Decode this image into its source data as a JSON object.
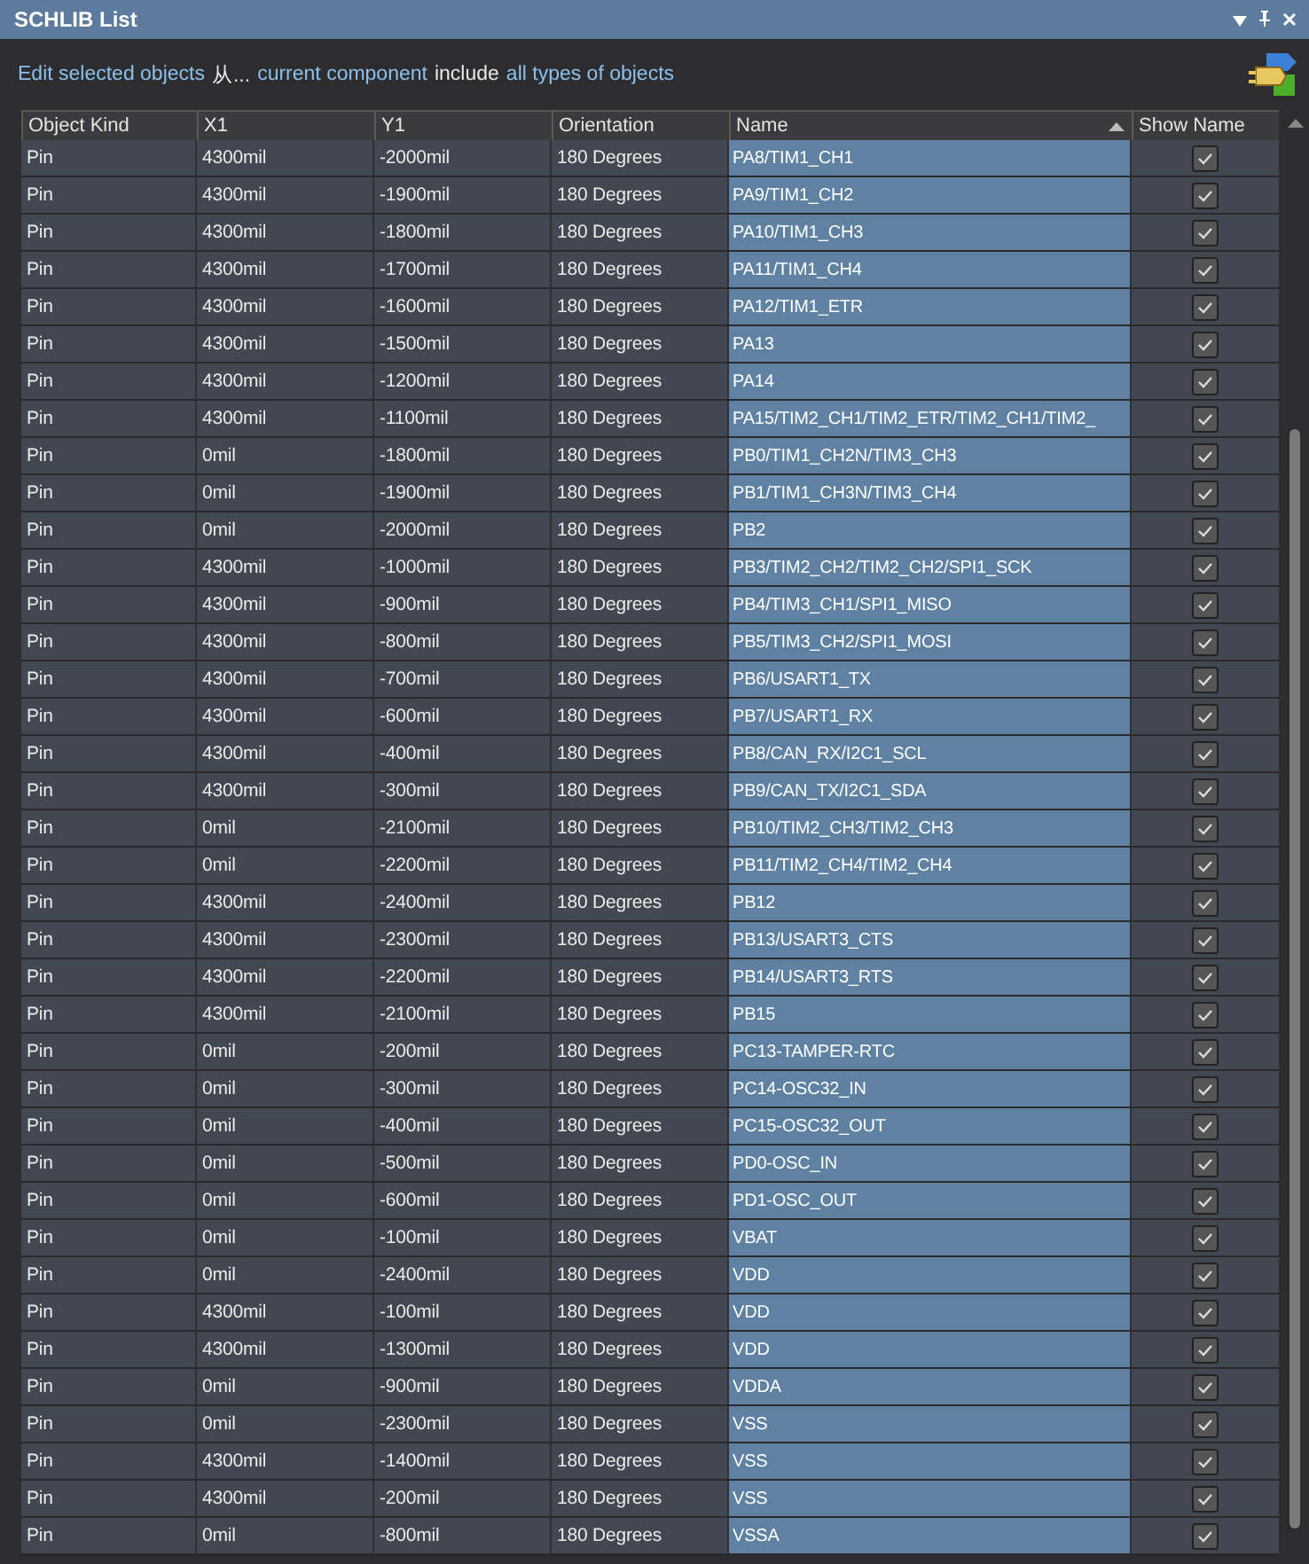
{
  "panel": {
    "title": "SCHLIB List",
    "buttons": [
      {
        "kind": "menu"
      },
      {
        "kind": "pin"
      },
      {
        "kind": "close"
      }
    ]
  },
  "filter": [
    {
      "kind": "link",
      "text": "Edit selected objects"
    },
    {
      "kind": "plain",
      "text": "从..."
    },
    {
      "kind": "link",
      "text": "current component"
    },
    {
      "kind": "plain",
      "text": "include"
    },
    {
      "kind": "link",
      "text": "all types of objects"
    }
  ],
  "table": {
    "columns": [
      {
        "label": "Object Kind",
        "sorted": false
      },
      {
        "label": "X1",
        "sorted": false
      },
      {
        "label": "Y1",
        "sorted": false
      },
      {
        "label": "Orientation",
        "sorted": false
      },
      {
        "label": "Name",
        "sorted": true
      },
      {
        "label": "Show Name",
        "sorted": false
      }
    ],
    "rows": [
      {
        "kind": "Pin",
        "x1": "4300mil",
        "y1": "-2000mil",
        "orientation": "180 Degrees",
        "name": "PA8/TIM1_CH1",
        "show_name": true,
        "selected": true
      },
      {
        "kind": "Pin",
        "x1": "4300mil",
        "y1": "-1900mil",
        "orientation": "180 Degrees",
        "name": "PA9/TIM1_CH2",
        "show_name": true,
        "selected": true
      },
      {
        "kind": "Pin",
        "x1": "4300mil",
        "y1": "-1800mil",
        "orientation": "180 Degrees",
        "name": "PA10/TIM1_CH3",
        "show_name": true,
        "selected": true
      },
      {
        "kind": "Pin",
        "x1": "4300mil",
        "y1": "-1700mil",
        "orientation": "180 Degrees",
        "name": "PA11/TIM1_CH4",
        "show_name": true,
        "selected": true
      },
      {
        "kind": "Pin",
        "x1": "4300mil",
        "y1": "-1600mil",
        "orientation": "180 Degrees",
        "name": "PA12/TIM1_ETR",
        "show_name": true,
        "selected": true
      },
      {
        "kind": "Pin",
        "x1": "4300mil",
        "y1": "-1500mil",
        "orientation": "180 Degrees",
        "name": "PA13",
        "show_name": true,
        "selected": true
      },
      {
        "kind": "Pin",
        "x1": "4300mil",
        "y1": "-1200mil",
        "orientation": "180 Degrees",
        "name": "PA14",
        "show_name": true,
        "selected": true
      },
      {
        "kind": "Pin",
        "x1": "4300mil",
        "y1": "-1100mil",
        "orientation": "180 Degrees",
        "name": "PA15/TIM2_CH1/TIM2_ETR/TIM2_CH1/TIM2_",
        "show_name": true,
        "selected": true
      },
      {
        "kind": "Pin",
        "x1": "0mil",
        "y1": "-1800mil",
        "orientation": "180 Degrees",
        "name": "PB0/TIM1_CH2N/TIM3_CH3",
        "show_name": true,
        "selected": true
      },
      {
        "kind": "Pin",
        "x1": "0mil",
        "y1": "-1900mil",
        "orientation": "180 Degrees",
        "name": "PB1/TIM1_CH3N/TIM3_CH4",
        "show_name": true,
        "selected": true
      },
      {
        "kind": "Pin",
        "x1": "0mil",
        "y1": "-2000mil",
        "orientation": "180 Degrees",
        "name": "PB2",
        "show_name": true,
        "selected": true
      },
      {
        "kind": "Pin",
        "x1": "4300mil",
        "y1": "-1000mil",
        "orientation": "180 Degrees",
        "name": "PB3/TIM2_CH2/TIM2_CH2/SPI1_SCK",
        "show_name": true,
        "selected": true
      },
      {
        "kind": "Pin",
        "x1": "4300mil",
        "y1": "-900mil",
        "orientation": "180 Degrees",
        "name": "PB4/TIM3_CH1/SPI1_MISO",
        "show_name": true,
        "selected": true
      },
      {
        "kind": "Pin",
        "x1": "4300mil",
        "y1": "-800mil",
        "orientation": "180 Degrees",
        "name": "PB5/TIM3_CH2/SPI1_MOSI",
        "show_name": true,
        "selected": true
      },
      {
        "kind": "Pin",
        "x1": "4300mil",
        "y1": "-700mil",
        "orientation": "180 Degrees",
        "name": "PB6/USART1_TX",
        "show_name": true,
        "selected": true
      },
      {
        "kind": "Pin",
        "x1": "4300mil",
        "y1": "-600mil",
        "orientation": "180 Degrees",
        "name": "PB7/USART1_RX",
        "show_name": true,
        "selected": true
      },
      {
        "kind": "Pin",
        "x1": "4300mil",
        "y1": "-400mil",
        "orientation": "180 Degrees",
        "name": "PB8/CAN_RX/I2C1_SCL",
        "show_name": true,
        "selected": true
      },
      {
        "kind": "Pin",
        "x1": "4300mil",
        "y1": "-300mil",
        "orientation": "180 Degrees",
        "name": "PB9/CAN_TX/I2C1_SDA",
        "show_name": true,
        "selected": true
      },
      {
        "kind": "Pin",
        "x1": "0mil",
        "y1": "-2100mil",
        "orientation": "180 Degrees",
        "name": "PB10/TIM2_CH3/TIM2_CH3",
        "show_name": true,
        "selected": true
      },
      {
        "kind": "Pin",
        "x1": "0mil",
        "y1": "-2200mil",
        "orientation": "180 Degrees",
        "name": "PB11/TIM2_CH4/TIM2_CH4",
        "show_name": true,
        "selected": true
      },
      {
        "kind": "Pin",
        "x1": "4300mil",
        "y1": "-2400mil",
        "orientation": "180 Degrees",
        "name": "PB12",
        "show_name": true,
        "selected": true
      },
      {
        "kind": "Pin",
        "x1": "4300mil",
        "y1": "-2300mil",
        "orientation": "180 Degrees",
        "name": "PB13/USART3_CTS",
        "show_name": true,
        "selected": true
      },
      {
        "kind": "Pin",
        "x1": "4300mil",
        "y1": "-2200mil",
        "orientation": "180 Degrees",
        "name": "PB14/USART3_RTS",
        "show_name": true,
        "selected": true
      },
      {
        "kind": "Pin",
        "x1": "4300mil",
        "y1": "-2100mil",
        "orientation": "180 Degrees",
        "name": "PB15",
        "show_name": true,
        "selected": true
      },
      {
        "kind": "Pin",
        "x1": "0mil",
        "y1": "-200mil",
        "orientation": "180 Degrees",
        "name": "PC13-TAMPER-RTC",
        "show_name": true,
        "selected": true
      },
      {
        "kind": "Pin",
        "x1": "0mil",
        "y1": "-300mil",
        "orientation": "180 Degrees",
        "name": "PC14-OSC32_IN",
        "show_name": true,
        "selected": true
      },
      {
        "kind": "Pin",
        "x1": "0mil",
        "y1": "-400mil",
        "orientation": "180 Degrees",
        "name": "PC15-OSC32_OUT",
        "show_name": true,
        "selected": true
      },
      {
        "kind": "Pin",
        "x1": "0mil",
        "y1": "-500mil",
        "orientation": "180 Degrees",
        "name": "PD0-OSC_IN",
        "show_name": true,
        "selected": true
      },
      {
        "kind": "Pin",
        "x1": "0mil",
        "y1": "-600mil",
        "orientation": "180 Degrees",
        "name": "PD1-OSC_OUT",
        "show_name": true,
        "selected": true
      },
      {
        "kind": "Pin",
        "x1": "0mil",
        "y1": "-100mil",
        "orientation": "180 Degrees",
        "name": "VBAT",
        "show_name": true,
        "selected": true
      },
      {
        "kind": "Pin",
        "x1": "0mil",
        "y1": "-2400mil",
        "orientation": "180 Degrees",
        "name": "VDD",
        "show_name": true,
        "selected": true
      },
      {
        "kind": "Pin",
        "x1": "4300mil",
        "y1": "-100mil",
        "orientation": "180 Degrees",
        "name": "VDD",
        "show_name": true,
        "selected": true
      },
      {
        "kind": "Pin",
        "x1": "4300mil",
        "y1": "-1300mil",
        "orientation": "180 Degrees",
        "name": "VDD",
        "show_name": true,
        "selected": true
      },
      {
        "kind": "Pin",
        "x1": "0mil",
        "y1": "-900mil",
        "orientation": "180 Degrees",
        "name": "VDDA",
        "show_name": true,
        "selected": true
      },
      {
        "kind": "Pin",
        "x1": "0mil",
        "y1": "-2300mil",
        "orientation": "180 Degrees",
        "name": "VSS",
        "show_name": true,
        "selected": true
      },
      {
        "kind": "Pin",
        "x1": "4300mil",
        "y1": "-1400mil",
        "orientation": "180 Degrees",
        "name": "VSS",
        "show_name": true,
        "selected": true
      },
      {
        "kind": "Pin",
        "x1": "4300mil",
        "y1": "-200mil",
        "orientation": "180 Degrees",
        "name": "VSS",
        "show_name": true,
        "selected": true
      },
      {
        "kind": "Pin",
        "x1": "0mil",
        "y1": "-800mil",
        "orientation": "180 Degrees",
        "name": "VSSA",
        "show_name": true,
        "selected": true
      }
    ]
  }
}
